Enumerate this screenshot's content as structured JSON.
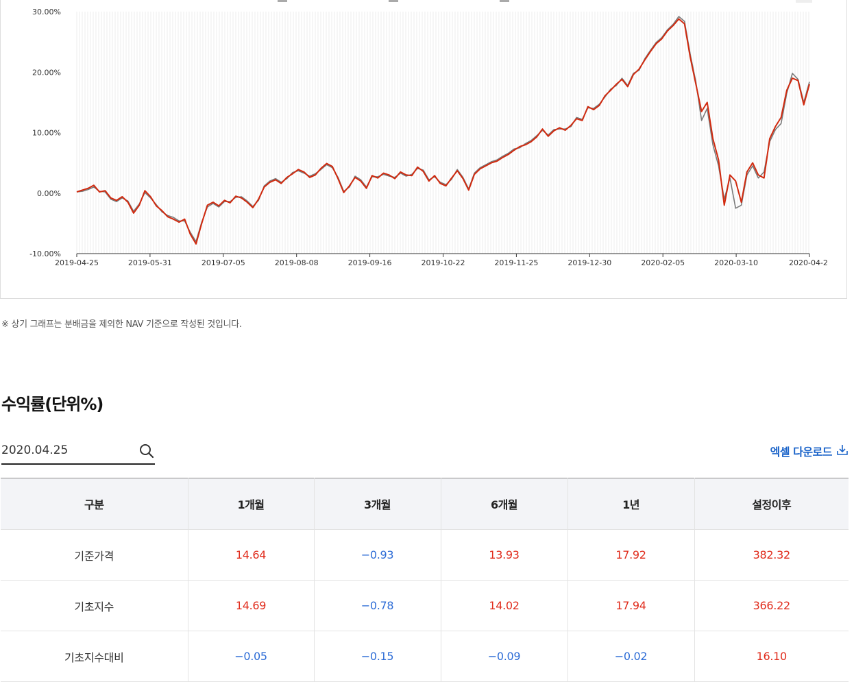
{
  "colors": {
    "fund_line": "#d12a0f",
    "index_line": "#7a7a7a",
    "positive": "#e02b1b",
    "negative": "#2d6cd6",
    "link": "#1a63c9"
  },
  "chart_data": {
    "type": "line",
    "y_ticks": [
      "30.00%",
      "20.00%",
      "10.00%",
      "0.00%",
      "-10.00%"
    ],
    "x_ticks": [
      "2019-04-25",
      "2019-05-31",
      "2019-07-05",
      "2019-08-08",
      "2019-09-16",
      "2019-10-22",
      "2019-11-25",
      "2019-12-30",
      "2020-02-05",
      "2020-03-10",
      "2020-04-2"
    ],
    "ylim": [
      -10,
      30
    ],
    "grid": "vertical",
    "series": [
      {
        "color": "#d12a0f",
        "values": [
          0.2,
          0.5,
          0.8,
          1.3,
          0.2,
          0.4,
          -0.8,
          -1.2,
          -0.6,
          -1.5,
          -3.3,
          -2.0,
          0.4,
          -0.6,
          -2.1,
          -2.9,
          -3.9,
          -4.3,
          -4.8,
          -4.3,
          -6.8,
          -8.4,
          -5.0,
          -2.0,
          -1.5,
          -2.1,
          -1.2,
          -1.6,
          -0.5,
          -0.8,
          -1.5,
          -2.4,
          -1.0,
          1.0,
          1.8,
          2.2,
          1.6,
          2.6,
          3.2,
          3.9,
          3.5,
          2.6,
          3.0,
          4.1,
          4.9,
          4.4,
          2.4,
          0.1,
          1.2,
          2.6,
          2.0,
          0.8,
          2.9,
          2.5,
          3.3,
          3.0,
          2.4,
          3.5,
          3.0,
          2.9,
          4.3,
          3.6,
          2.0,
          2.9,
          1.6,
          1.2,
          2.5,
          3.7,
          2.4,
          0.5,
          3.1,
          4.0,
          4.5,
          5.0,
          5.3,
          5.9,
          6.4,
          7.1,
          7.7,
          8.0,
          8.5,
          9.3,
          10.6,
          9.4,
          10.3,
          10.8,
          10.4,
          11.2,
          12.3,
          12.0,
          14.3,
          13.8,
          14.5,
          16.1,
          17.0,
          18.0,
          18.8,
          17.6,
          19.6,
          20.5,
          22.0,
          23.4,
          24.7,
          25.5,
          26.8,
          27.7,
          28.8,
          28.0,
          22.5,
          18.0,
          13.5,
          15.0,
          9.0,
          5.5,
          -2.0,
          3.0,
          2.0,
          -1.5,
          3.5,
          5.0,
          3.0,
          2.5,
          9.0,
          11.0,
          12.5,
          17.0,
          19.0,
          18.6,
          14.6,
          18.0
        ]
      },
      {
        "color": "#7a7a7a",
        "values": [
          0.2,
          0.3,
          0.6,
          1.0,
          0.3,
          0.2,
          -1.0,
          -1.4,
          -0.8,
          -1.3,
          -3.0,
          -1.8,
          0.1,
          -0.8,
          -1.9,
          -3.1,
          -3.7,
          -4.0,
          -4.6,
          -4.6,
          -6.5,
          -8.0,
          -4.8,
          -2.3,
          -1.7,
          -2.3,
          -1.4,
          -1.4,
          -0.7,
          -0.6,
          -1.3,
          -2.2,
          -1.2,
          1.2,
          2.0,
          2.4,
          1.8,
          2.4,
          3.4,
          3.7,
          3.3,
          2.8,
          3.2,
          3.9,
          4.7,
          4.2,
          2.6,
          0.3,
          1.0,
          2.8,
          2.2,
          1.0,
          2.7,
          2.7,
          3.1,
          2.8,
          2.6,
          3.3,
          2.8,
          3.1,
          4.1,
          3.8,
          2.2,
          2.7,
          1.8,
          1.4,
          2.3,
          3.9,
          2.6,
          0.7,
          3.3,
          4.2,
          4.7,
          5.2,
          5.5,
          6.1,
          6.6,
          7.3,
          7.5,
          8.2,
          8.7,
          9.5,
          10.4,
          9.6,
          10.5,
          10.6,
          10.6,
          11.0,
          12.5,
          12.2,
          14.1,
          14.0,
          14.7,
          15.9,
          17.2,
          17.8,
          19.0,
          17.8,
          19.8,
          20.3,
          22.2,
          23.6,
          24.9,
          25.7,
          27.0,
          27.9,
          29.2,
          28.4,
          23.0,
          18.4,
          12.0,
          14.0,
          8.0,
          4.5,
          -1.0,
          2.5,
          -2.5,
          -2.0,
          3.0,
          4.5,
          2.5,
          3.5,
          8.5,
          10.5,
          11.5,
          16.5,
          19.8,
          18.8,
          15.0,
          18.4
        ]
      }
    ]
  },
  "note": "※ 상기 그래프는 분배금을 제외한 NAV 기준으로 작성된 것입니다.",
  "section_title": "수익률(단위%)",
  "search": {
    "value": "2020.04.25",
    "icon": "search-icon"
  },
  "excel": {
    "label": "엑셀 다운로드",
    "icon": "download-icon"
  },
  "table": {
    "headers": [
      "구분",
      "1개월",
      "3개월",
      "6개월",
      "1년",
      "설정이후"
    ],
    "rows": [
      {
        "label": "기준가격",
        "values": [
          "14.64",
          "−0.93",
          "13.93",
          "17.92",
          "382.32"
        ]
      },
      {
        "label": "기초지수",
        "values": [
          "14.69",
          "−0.78",
          "14.02",
          "17.94",
          "366.22"
        ]
      },
      {
        "label": "기초지수대비",
        "values": [
          "−0.05",
          "−0.15",
          "−0.09",
          "−0.02",
          "16.10"
        ]
      }
    ]
  }
}
